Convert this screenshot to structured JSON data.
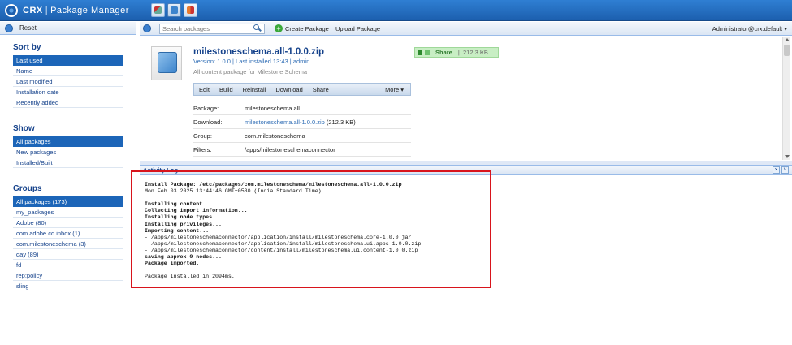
{
  "app": {
    "brand": "CRX",
    "separator": "|",
    "name": "Package Manager"
  },
  "sidebar": {
    "toolbar": {
      "reset_label": "Reset"
    },
    "sort_by": {
      "heading": "Sort by",
      "items": [
        "Last used",
        "Name",
        "Last modified",
        "Installation date",
        "Recently added"
      ],
      "selected": "Last used"
    },
    "show": {
      "heading": "Show",
      "items": [
        "All packages",
        "New packages",
        "Installed/Built"
      ],
      "selected": "All packages"
    },
    "groups": {
      "heading": "Groups",
      "items": [
        "All packages (173)",
        "my_packages",
        "Adobe (80)",
        "com.adobe.cq.inbox (1)",
        "com.milestoneschema (3)",
        "day (89)",
        "fd",
        "rep:policy",
        "sling"
      ],
      "selected": "All packages (173)"
    }
  },
  "toolbar": {
    "search_placeholder": "Search packages",
    "create_label": "Create Package",
    "upload_label": "Upload Package",
    "user": "Administrator@crx.default ▾"
  },
  "package": {
    "name": "milestoneschema.all-1.0.0.zip",
    "version_prefix": "Version:",
    "version": "1.0.0",
    "installed_prefix": "Last installed",
    "installed_time": "13:43",
    "installed_by": "admin",
    "description": "All content package for Milestone Schema",
    "share_label": "Share",
    "share_size": "212.3 KB",
    "actions": [
      "Edit",
      "Build",
      "Reinstall",
      "Download",
      "Share"
    ],
    "more_label": "More ▾",
    "properties": [
      {
        "label": "Package:",
        "value": "milestoneschema.all",
        "link": ""
      },
      {
        "label": "Download:",
        "value": " (212.3 KB)",
        "link": "milestoneschema.all-1.0.0.zip"
      },
      {
        "label": "Group:",
        "value": "com.milestoneschema",
        "link": ""
      },
      {
        "label": "Filters:",
        "value": "/apps/milestoneschemaconnector",
        "link": ""
      }
    ]
  },
  "activity_log": {
    "title": "Activity Log",
    "lines": [
      {
        "text": "Install Package: /etc/packages/com.milestoneschema/milestoneschema.all-1.0.0.zip",
        "bold": true
      },
      {
        "text": "Mon Feb 03 2025 13:44:46 GMT+0530 (India Standard Time)",
        "bold": false
      },
      {
        "text": "",
        "bold": false
      },
      {
        "text": "Installing content",
        "bold": true
      },
      {
        "text": "Collecting import information...",
        "bold": true
      },
      {
        "text": "Installing node types...",
        "bold": true
      },
      {
        "text": "Installing privileges...",
        "bold": true
      },
      {
        "text": "Importing content...",
        "bold": true
      },
      {
        "text": "- /apps/milestoneschemaconnector/application/install/milestoneschema.core-1.0.0.jar",
        "bold": false
      },
      {
        "text": "- /apps/milestoneschemaconnector/application/install/milestoneschema.ui.apps-1.0.0.zip",
        "bold": false
      },
      {
        "text": "- /apps/milestoneschemaconnector/content/install/milestoneschema.ui.content-1.0.0.zip",
        "bold": false
      },
      {
        "text": "saving approx 0 nodes...",
        "bold": true
      },
      {
        "text": "Package imported.",
        "bold": true
      },
      {
        "text": "",
        "bold": false
      },
      {
        "text": "Package installed in 2094ms.",
        "bold": false
      }
    ]
  }
}
